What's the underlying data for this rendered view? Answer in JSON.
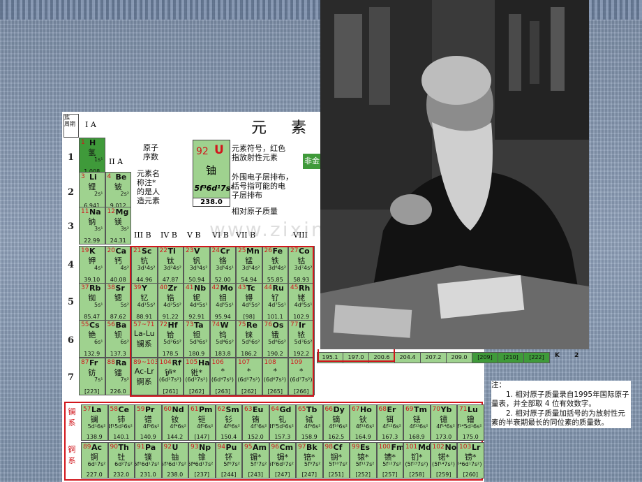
{
  "title": "元 素 周",
  "watermark": "www.zixin.com.cn",
  "period_header": "族\n周期",
  "groups": {
    "IA": "I A",
    "IIA": "II A",
    "IIIB": "III B",
    "IVB": "IV B",
    "VB": "V B",
    "VIB": "VI B",
    "VIIB": "VII B",
    "VIII": "VIII"
  },
  "legend": {
    "atomic_number_label": "原子\n序数",
    "name_label": "元素名\n称注*\n的是人\n造元素",
    "example_number": "92",
    "example_symbol": "U",
    "example_name": "铀",
    "example_config": "5f³6d¹7s²",
    "example_mass": "238.0",
    "symbol_desc": "元素符号，红色\n指放射性元素",
    "config_desc": "外围电子层排布，\n括号指可能的电\n子层排布",
    "mass_desc": "相对原子质量",
    "nonmetal_badge": "非金"
  },
  "periods": [
    "1",
    "2",
    "3",
    "4",
    "5",
    "6",
    "7"
  ],
  "elements": [
    {
      "n": "1",
      "s": "H",
      "cn": "氢",
      "cfg": "1s¹",
      "m": "1.008",
      "c": 1,
      "r": 1,
      "bg": "dg"
    },
    {
      "n": "3",
      "s": "Li",
      "cn": "锂",
      "cfg": "2s¹",
      "m": "6.941",
      "c": 1,
      "r": 2,
      "bg": "g"
    },
    {
      "n": "4",
      "s": "Be",
      "cn": "铍",
      "cfg": "2s²",
      "m": "9.012",
      "c": 2,
      "r": 2,
      "bg": "g"
    },
    {
      "n": "11",
      "s": "Na",
      "cn": "钠",
      "cfg": "3s¹",
      "m": "22.99",
      "c": 1,
      "r": 3,
      "bg": "g"
    },
    {
      "n": "12",
      "s": "Mg",
      "cn": "镁",
      "cfg": "3s²",
      "m": "24.31",
      "c": 2,
      "r": 3,
      "bg": "g"
    },
    {
      "n": "19",
      "s": "K",
      "cn": "钾",
      "cfg": "4s¹",
      "m": "39.10",
      "c": 1,
      "r": 4,
      "bg": "g"
    },
    {
      "n": "20",
      "s": "Ca",
      "cn": "钙",
      "cfg": "4s²",
      "m": "40.08",
      "c": 2,
      "r": 4,
      "bg": "g"
    },
    {
      "n": "21",
      "s": "Sc",
      "cn": "钪",
      "cfg": "3d¹4s²",
      "m": "44.96",
      "c": 3,
      "r": 4,
      "bg": "g"
    },
    {
      "n": "22",
      "s": "Ti",
      "cn": "钛",
      "cfg": "3d²4s²",
      "m": "47.87",
      "c": 4,
      "r": 4,
      "bg": "g"
    },
    {
      "n": "23",
      "s": "V",
      "cn": "钒",
      "cfg": "3d³4s²",
      "m": "50.94",
      "c": 5,
      "r": 4,
      "bg": "g"
    },
    {
      "n": "24",
      "s": "Cr",
      "cn": "铬",
      "cfg": "3d⁵4s¹",
      "m": "52.00",
      "c": 6,
      "r": 4,
      "bg": "g"
    },
    {
      "n": "25",
      "s": "Mn",
      "cn": "锰",
      "cfg": "3d⁵4s²",
      "m": "54.94",
      "c": 7,
      "r": 4,
      "bg": "g"
    },
    {
      "n": "26",
      "s": "Fe",
      "cn": "铁",
      "cfg": "3d⁶4s²",
      "m": "55.85",
      "c": 8,
      "r": 4,
      "bg": "g"
    },
    {
      "n": "27",
      "s": "Co",
      "cn": "钴",
      "cfg": "3d⁷4s²",
      "m": "58.93",
      "c": 9,
      "r": 4,
      "bg": "g"
    },
    {
      "n": "37",
      "s": "Rb",
      "cn": "铷",
      "cfg": "5s¹",
      "m": "85.47",
      "c": 1,
      "r": 5,
      "bg": "g"
    },
    {
      "n": "38",
      "s": "Sr",
      "cn": "锶",
      "cfg": "5s²",
      "m": "87.62",
      "c": 2,
      "r": 5,
      "bg": "g"
    },
    {
      "n": "39",
      "s": "Y",
      "cn": "钇",
      "cfg": "4d¹5s²",
      "m": "88.91",
      "c": 3,
      "r": 5,
      "bg": "g"
    },
    {
      "n": "40",
      "s": "Zr",
      "cn": "锆",
      "cfg": "4d²5s²",
      "m": "91.22",
      "c": 4,
      "r": 5,
      "bg": "g"
    },
    {
      "n": "41",
      "s": "Nb",
      "cn": "铌",
      "cfg": "4d⁴5s¹",
      "m": "92.91",
      "c": 5,
      "r": 5,
      "bg": "g"
    },
    {
      "n": "42",
      "s": "Mo",
      "cn": "钼",
      "cfg": "4d⁵5s¹",
      "m": "95.94",
      "c": 6,
      "r": 5,
      "bg": "g"
    },
    {
      "n": "43",
      "s": "Tc",
      "cn": "锝",
      "cfg": "4d⁵5s²",
      "m": "[98]",
      "c": 7,
      "r": 5,
      "bg": "g"
    },
    {
      "n": "44",
      "s": "Ru",
      "cn": "钌",
      "cfg": "4d⁷5s¹",
      "m": "101.1",
      "c": 8,
      "r": 5,
      "bg": "g"
    },
    {
      "n": "45",
      "s": "Rh",
      "cn": "铑",
      "cfg": "4d⁸5s¹",
      "m": "102.9",
      "c": 9,
      "r": 5,
      "bg": "g"
    },
    {
      "n": "55",
      "s": "Cs",
      "cn": "铯",
      "cfg": "6s¹",
      "m": "132.9",
      "c": 1,
      "r": 6,
      "bg": "g"
    },
    {
      "n": "56",
      "s": "Ba",
      "cn": "钡",
      "cfg": "6s²",
      "m": "137.3",
      "c": 2,
      "r": 6,
      "bg": "g"
    },
    {
      "n": "57~71",
      "s": "",
      "cn": "La-Lu\n镧系",
      "cfg": "",
      "m": "",
      "c": 3,
      "r": 6,
      "bg": "g"
    },
    {
      "n": "72",
      "s": "Hf",
      "cn": "铪",
      "cfg": "5d²6s²",
      "m": "178.5",
      "c": 4,
      "r": 6,
      "bg": "g"
    },
    {
      "n": "73",
      "s": "Ta",
      "cn": "钽",
      "cfg": "5d³6s²",
      "m": "180.9",
      "c": 5,
      "r": 6,
      "bg": "g"
    },
    {
      "n": "74",
      "s": "W",
      "cn": "钨",
      "cfg": "5d⁴6s²",
      "m": "183.8",
      "c": 6,
      "r": 6,
      "bg": "g"
    },
    {
      "n": "75",
      "s": "Re",
      "cn": "铼",
      "cfg": "5d⁵6s²",
      "m": "186.2",
      "c": 7,
      "r": 6,
      "bg": "g"
    },
    {
      "n": "76",
      "s": "Os",
      "cn": "锇",
      "cfg": "5d⁶6s²",
      "m": "190.2",
      "c": 8,
      "r": 6,
      "bg": "g"
    },
    {
      "n": "77",
      "s": "Ir",
      "cn": "铱",
      "cfg": "5d⁷6s²",
      "m": "192.2",
      "c": 9,
      "r": 6,
      "bg": "g"
    },
    {
      "n": "87",
      "s": "Fr",
      "cn": "钫",
      "cfg": "7s¹",
      "m": "[223]",
      "c": 1,
      "r": 7,
      "bg": "g"
    },
    {
      "n": "88",
      "s": "Ra",
      "cn": "镭",
      "cfg": "7s²",
      "m": "226.0",
      "c": 2,
      "r": 7,
      "bg": "g"
    },
    {
      "n": "89~103",
      "s": "",
      "cn": "Ac-Lr\n锕系",
      "cfg": "",
      "m": "",
      "c": 3,
      "r": 7,
      "bg": "g"
    },
    {
      "n": "104",
      "s": "Rf",
      "cn": "𬬻*",
      "cfg": "(6d²7s²)",
      "m": "[261]",
      "c": 4,
      "r": 7,
      "bg": "g"
    },
    {
      "n": "105",
      "s": "Ha",
      "cn": "𬭊*",
      "cfg": "(6d³7s²)",
      "m": "[262]",
      "c": 5,
      "r": 7,
      "bg": "g"
    },
    {
      "n": "106",
      "s": "",
      "cn": "*",
      "cfg": "(6d⁴7s²)",
      "m": "[263]",
      "c": 6,
      "r": 7,
      "bg": "g"
    },
    {
      "n": "107",
      "s": "",
      "cn": "*",
      "cfg": "(6d⁵7s²)",
      "m": "[262]",
      "c": 7,
      "r": 7,
      "bg": "g"
    },
    {
      "n": "108",
      "s": "",
      "cn": "*",
      "cfg": "(6d⁶7s²)",
      "m": "[265]",
      "c": 8,
      "r": 7,
      "bg": "g"
    },
    {
      "n": "109",
      "s": "",
      "cn": "*",
      "cfg": "(6d⁷7s²)",
      "m": "[266]",
      "c": 9,
      "r": 7,
      "bg": "g"
    }
  ],
  "partial_row6_right": [
    "195.1",
    "197.0",
    "200.6",
    "204.4",
    "207.2",
    "209.0",
    "[209]",
    "[210]",
    "[222]"
  ],
  "partial_shell": [
    "K",
    "2"
  ],
  "series_labels": {
    "lan": "镧系",
    "act": "锕系"
  },
  "lanthanides": [
    {
      "n": "57",
      "s": "La",
      "cn": "镧",
      "cfg": "5d¹6s²",
      "m": "138.9"
    },
    {
      "n": "58",
      "s": "Ce",
      "cn": "铈",
      "cfg": "4f¹5d¹6s²",
      "m": "140.1"
    },
    {
      "n": "59",
      "s": "Pr",
      "cn": "镨",
      "cfg": "4f³6s²",
      "m": "140.9"
    },
    {
      "n": "60",
      "s": "Nd",
      "cn": "钕",
      "cfg": "4f⁴6s²",
      "m": "144.2"
    },
    {
      "n": "61",
      "s": "Pm",
      "cn": "钷",
      "cfg": "4f⁵6s²",
      "m": "[147]"
    },
    {
      "n": "62",
      "s": "Sm",
      "cn": "钐",
      "cfg": "4f⁶6s²",
      "m": "150.4"
    },
    {
      "n": "63",
      "s": "Eu",
      "cn": "铕",
      "cfg": "4f⁷6s²",
      "m": "152.0"
    },
    {
      "n": "64",
      "s": "Gd",
      "cn": "钆",
      "cfg": "4f⁷5d¹6s²",
      "m": "157.3"
    },
    {
      "n": "65",
      "s": "Tb",
      "cn": "铽",
      "cfg": "4f⁹6s²",
      "m": "158.9"
    },
    {
      "n": "66",
      "s": "Dy",
      "cn": "镝",
      "cfg": "4f¹⁰6s²",
      "m": "162.5"
    },
    {
      "n": "67",
      "s": "Ho",
      "cn": "钬",
      "cfg": "4f¹¹6s²",
      "m": "164.9"
    },
    {
      "n": "68",
      "s": "Er",
      "cn": "铒",
      "cfg": "4f¹²6s²",
      "m": "167.3"
    },
    {
      "n": "69",
      "s": "Tm",
      "cn": "铥",
      "cfg": "4f¹³6s²",
      "m": "168.9"
    },
    {
      "n": "70",
      "s": "Yb",
      "cn": "镱",
      "cfg": "4f¹⁴6s²",
      "m": "173.0"
    },
    {
      "n": "71",
      "s": "Lu",
      "cn": "镥",
      "cfg": "4f¹⁴5d¹6s²",
      "m": "175.0"
    }
  ],
  "actinides": [
    {
      "n": "89",
      "s": "Ac",
      "cn": "锕",
      "cfg": "6d¹7s²",
      "m": "227.0"
    },
    {
      "n": "90",
      "s": "Th",
      "cn": "钍",
      "cfg": "6d²7s²",
      "m": "232.0"
    },
    {
      "n": "91",
      "s": "Pa",
      "cn": "镤",
      "cfg": "5f²6d¹7s²",
      "m": "231.0"
    },
    {
      "n": "92",
      "s": "U",
      "cn": "铀",
      "cfg": "5f³6d¹7s²",
      "m": "238.0"
    },
    {
      "n": "93",
      "s": "Np",
      "cn": "镎",
      "cfg": "5f⁴6d¹7s²",
      "m": "[237]"
    },
    {
      "n": "94",
      "s": "Pu",
      "cn": "钚",
      "cfg": "5f⁶7s²",
      "m": "[244]"
    },
    {
      "n": "95",
      "s": "Am",
      "cn": "镅*",
      "cfg": "5f⁷7s²",
      "m": "[243]"
    },
    {
      "n": "96",
      "s": "Cm",
      "cn": "锔*",
      "cfg": "5f⁷6d¹7s²",
      "m": "[247]"
    },
    {
      "n": "97",
      "s": "Bk",
      "cn": "锫*",
      "cfg": "5f⁹7s²",
      "m": "[247]"
    },
    {
      "n": "98",
      "s": "Cf",
      "cn": "锎*",
      "cfg": "5f¹⁰7s²",
      "m": "[251]"
    },
    {
      "n": "99",
      "s": "Es",
      "cn": "锿*",
      "cfg": "5f¹¹7s²",
      "m": "[252]"
    },
    {
      "n": "100",
      "s": "Fm",
      "cn": "镄*",
      "cfg": "5f¹²7s²",
      "m": "[257]"
    },
    {
      "n": "101",
      "s": "Md",
      "cn": "钔*",
      "cfg": "(5f¹³7s²)",
      "m": "[258]"
    },
    {
      "n": "102",
      "s": "No",
      "cn": "锘*",
      "cfg": "(5f¹⁴7s²)",
      "m": "[259]"
    },
    {
      "n": "103",
      "s": "Lr",
      "cn": "铹*",
      "cfg": "(5f¹⁴6d¹7s²)",
      "m": "[260]"
    }
  ],
  "notes": {
    "heading": "注：",
    "note1": "1. 相对原子质量录自1995年国际原子量表，并全部取 4 位有效数字。",
    "note2": "2. 相对原子质量加括号的为放射性元素的半衰期最长的同位素的质量数。"
  },
  "colors": {
    "accent_red": "#d1161c",
    "cell_green": "#9fd28f",
    "dark_green": "#3f9a3a"
  }
}
